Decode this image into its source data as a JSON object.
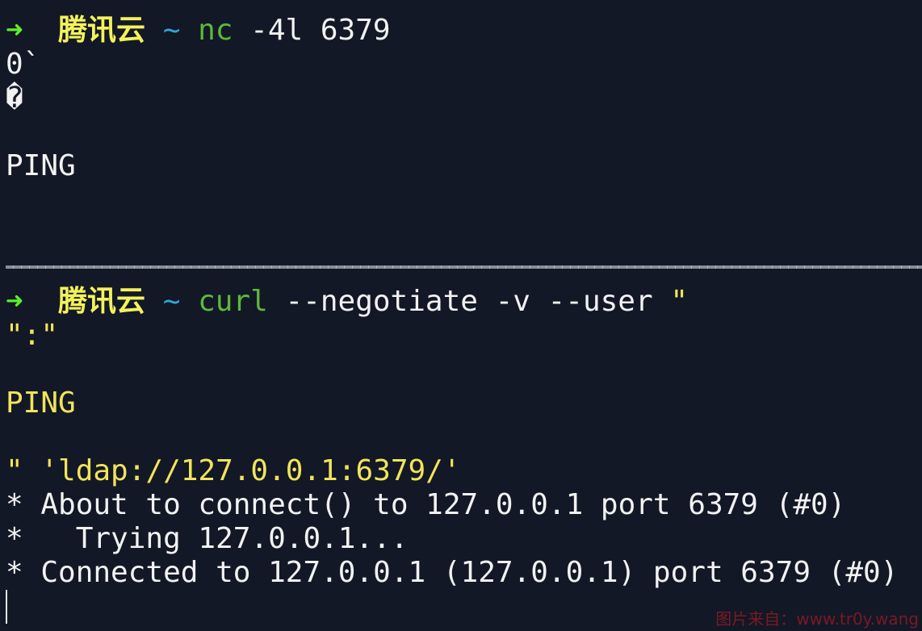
{
  "top_pane": {
    "prompt": {
      "arrow": "➜",
      "host": "腾讯云",
      "dir": "~",
      "cmd": "nc",
      "args": " -4l 6379"
    },
    "output": [
      "0`",
      "�",
      "",
      "PING"
    ]
  },
  "bottom_pane": {
    "prompt": {
      "arrow": "➜",
      "host": "腾讯云",
      "dir": "~",
      "cmd": "curl",
      "args": " --negotiate -v --user ",
      "quote": "\""
    },
    "arg_lines": [
      "\":\"",
      "",
      "PING",
      "",
      "\" 'ldap://127.0.0.1:6379/'"
    ],
    "output": [
      "* About to connect() to 127.0.0.1 port 6379 (#0)",
      "*   Trying 127.0.0.1...",
      "* Connected to 127.0.0.1 (127.0.0.1) port 6379 (#0)"
    ]
  },
  "watermark": "图片来自：www.tr0y.wang",
  "colors": {
    "background": "#121826",
    "prompt_arrow": "#5ef02a",
    "host": "#f4f25a",
    "tilde": "#2ea8d8",
    "command": "#5fb83a"
  }
}
